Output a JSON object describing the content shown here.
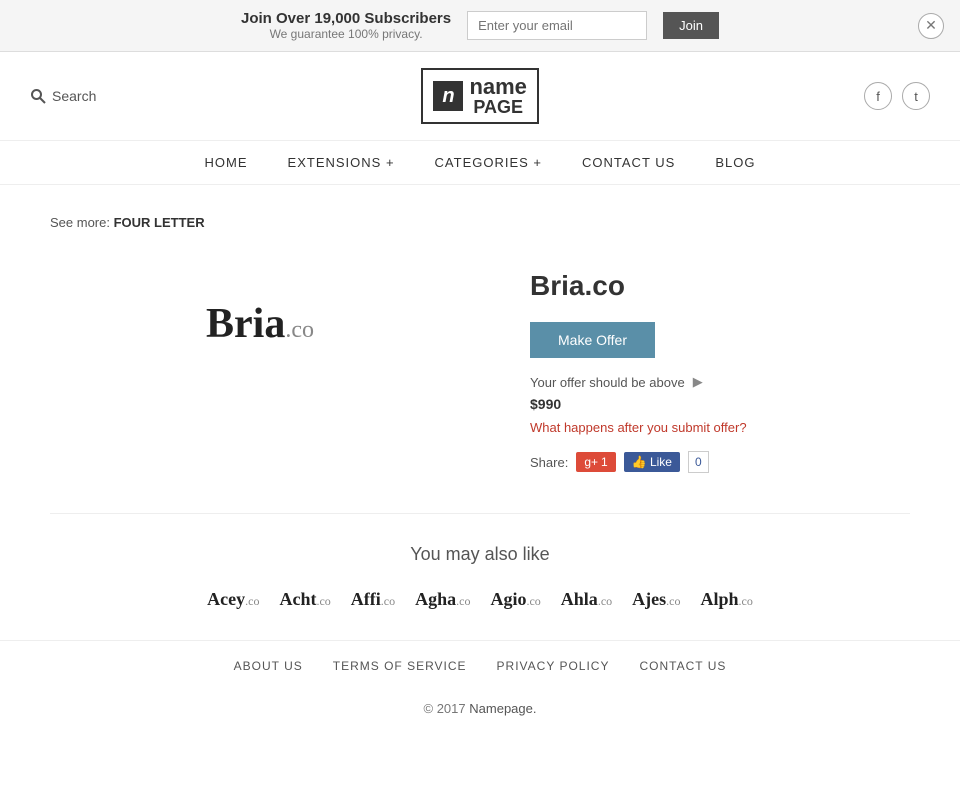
{
  "banner": {
    "title": "Join Over 19,000 Subscribers",
    "subtitle": "We guarantee 100% privacy.",
    "email_placeholder": "Enter your email",
    "join_label": "Join"
  },
  "header": {
    "search_label": "Search",
    "logo_n": "n",
    "logo_name": "name",
    "logo_page": "PAGE"
  },
  "nav": {
    "items": [
      {
        "label": "HOME",
        "id": "home"
      },
      {
        "label": "EXTENSIONS +",
        "id": "extensions"
      },
      {
        "label": "CATEGORIES +",
        "id": "categories"
      },
      {
        "label": "CONTACT  US",
        "id": "contact"
      },
      {
        "label": "BLOG",
        "id": "blog"
      }
    ]
  },
  "see_more": {
    "prefix": "See more:",
    "link": "FOUR LETTER"
  },
  "domain": {
    "name": "Bria",
    "ext": ".co",
    "full": "Bria.co",
    "make_offer_label": "Make Offer",
    "offer_note": "Your offer should be above",
    "offer_price": "$990",
    "what_happens": "What happens after you submit offer?",
    "share_label": "Share:"
  },
  "also_like": {
    "heading": "You may also like",
    "domains": [
      {
        "name": "Acey",
        "ext": ".co"
      },
      {
        "name": "Acht",
        "ext": ".co"
      },
      {
        "name": "Affi",
        "ext": ".co"
      },
      {
        "name": "Agha",
        "ext": ".co"
      },
      {
        "name": "Agio",
        "ext": ".co"
      },
      {
        "name": "Ahla",
        "ext": ".co"
      },
      {
        "name": "Ajes",
        "ext": ".co"
      },
      {
        "name": "Alph",
        "ext": ".co"
      }
    ]
  },
  "footer": {
    "links": [
      {
        "label": "ABOUT  US",
        "id": "about"
      },
      {
        "label": "TERMS  OF  SERVICE",
        "id": "tos"
      },
      {
        "label": "PRIVACY  POLICY",
        "id": "privacy"
      },
      {
        "label": "CONTACT  US",
        "id": "contact"
      }
    ],
    "copy_prefix": "© 2017",
    "copy_brand": "Namepage.",
    "copy_suffix": ""
  }
}
